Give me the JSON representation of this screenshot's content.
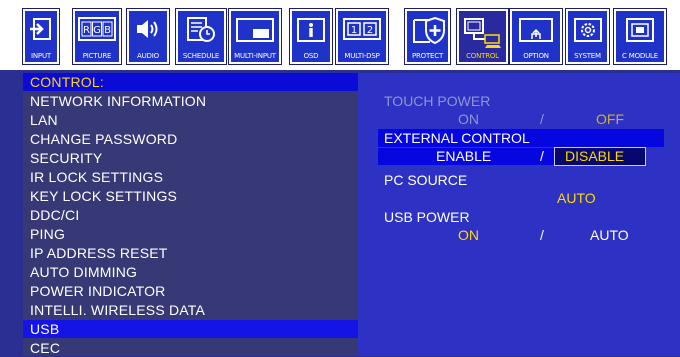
{
  "toolbar": {
    "buttons": [
      {
        "label": "INPUT",
        "icon": "input-arrow-icon"
      },
      {
        "label": "PICTURE",
        "icon": "rgb-icon"
      },
      {
        "label": "AUDIO",
        "icon": "speaker-icon"
      },
      {
        "label": "SCHEDULE",
        "icon": "schedule-icon"
      },
      {
        "label": "MULTI-INPUT",
        "icon": "multi-input-icon"
      },
      {
        "label": "OSD",
        "icon": "info-icon"
      },
      {
        "label": "MULTI-DSP",
        "icon": "multi-display-icon"
      },
      {
        "label": "PROTECT",
        "icon": "shield-icon"
      },
      {
        "label": "CONTROL",
        "icon": "network-control-icon"
      },
      {
        "label": "OPTION",
        "icon": "option-monitor-icon"
      },
      {
        "label": "SYSTEM",
        "icon": "gear-icon"
      },
      {
        "label": "C MODULE",
        "icon": "compute-module-icon"
      }
    ],
    "active_label": "CONTROL"
  },
  "menu": {
    "header": "CONTROL:",
    "items": [
      "NETWORK INFORMATION",
      "LAN",
      "CHANGE PASSWORD",
      "SECURITY",
      "IR LOCK SETTINGS",
      "KEY LOCK SETTINGS",
      "DDC/CI",
      "PING",
      "IP ADDRESS RESET",
      "AUTO DIMMING",
      "POWER INDICATOR",
      "INTELLI. WIRELESS DATA",
      "USB",
      "CEC"
    ],
    "selected": "USB"
  },
  "settings": {
    "touch_power": {
      "label": "TOUCH POWER",
      "opt1": "ON",
      "sep": "/",
      "opt2": "OFF"
    },
    "external_control": {
      "label": "EXTERNAL CONTROL",
      "opt1": "ENABLE",
      "sep": "/",
      "opt2": "DISABLE"
    },
    "pc_source": {
      "label": "PC SOURCE",
      "value": "AUTO"
    },
    "usb_power": {
      "label": "USB POWER",
      "opt1": "ON",
      "sep": "/",
      "opt2": "AUTO"
    }
  },
  "colors": {
    "toolbar_bg": "#ffffff",
    "button_bg": "#1f33c8",
    "menu_bg": "#373976",
    "header_bg": "#0b0bd8",
    "right_bg": "#2d31c4",
    "highlight": "#ffd900"
  }
}
